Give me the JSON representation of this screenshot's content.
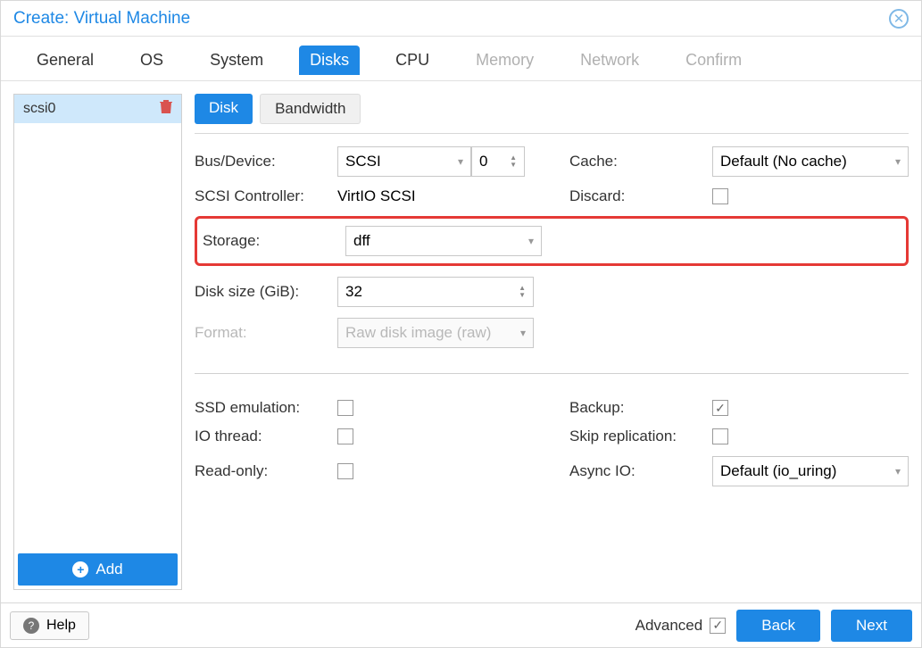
{
  "title": "Create: Virtual Machine",
  "tabs": [
    "General",
    "OS",
    "System",
    "Disks",
    "CPU",
    "Memory",
    "Network",
    "Confirm"
  ],
  "active_tab": 3,
  "disabled_tabs": [
    5,
    6,
    7
  ],
  "sidebar": {
    "items": [
      "scsi0"
    ],
    "add_label": "Add"
  },
  "subtabs": {
    "disk": "Disk",
    "bandwidth": "Bandwidth"
  },
  "form": {
    "bus_device_label": "Bus/Device:",
    "bus_value": "SCSI",
    "device_num": "0",
    "cache_label": "Cache:",
    "cache_value": "Default (No cache)",
    "scsi_ctrl_label": "SCSI Controller:",
    "scsi_ctrl_value": "VirtIO SCSI",
    "discard_label": "Discard:",
    "storage_label": "Storage:",
    "storage_value": "dff",
    "disk_size_label": "Disk size (GiB):",
    "disk_size_value": "32",
    "format_label": "Format:",
    "format_value": "Raw disk image (raw)",
    "ssd_label": "SSD emulation:",
    "backup_label": "Backup:",
    "io_thread_label": "IO thread:",
    "skip_repl_label": "Skip replication:",
    "readonly_label": "Read-only:",
    "asyncio_label": "Async IO:",
    "asyncio_value": "Default (io_uring)"
  },
  "footer": {
    "help": "Help",
    "advanced": "Advanced",
    "back": "Back",
    "next": "Next"
  }
}
